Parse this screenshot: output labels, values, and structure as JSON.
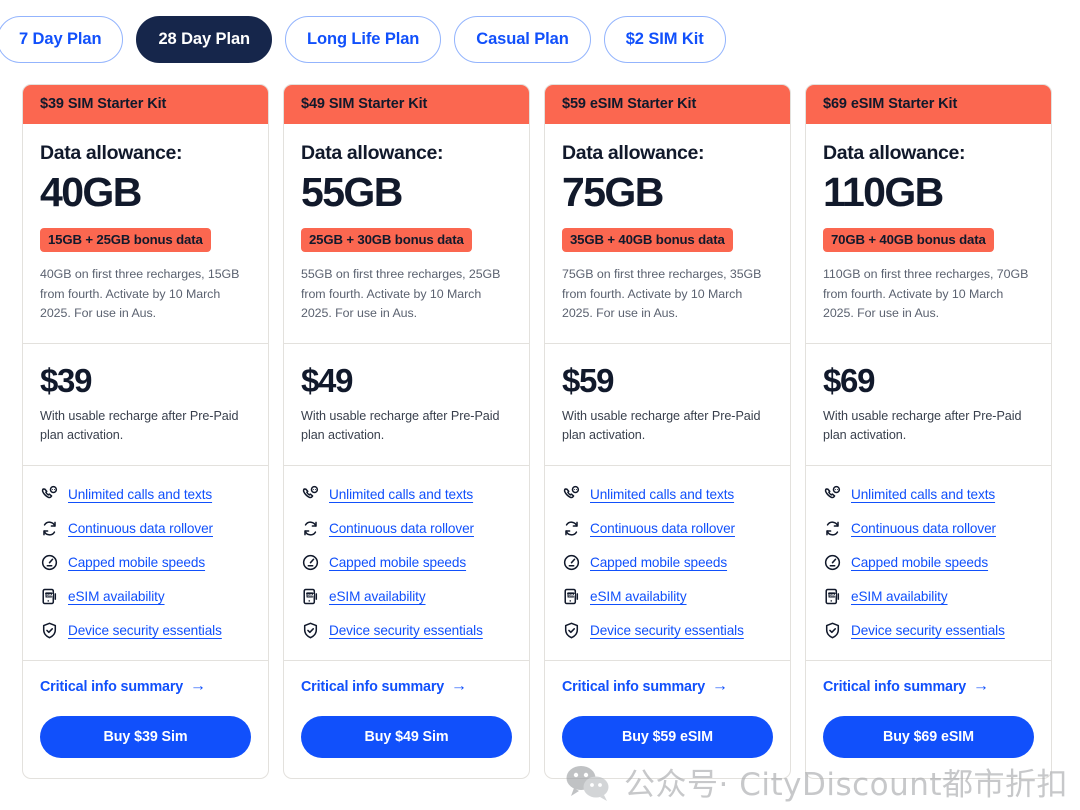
{
  "tabs": [
    {
      "label": "7 Day Plan",
      "active": false
    },
    {
      "label": "28 Day Plan",
      "active": true
    },
    {
      "label": "Long Life Plan",
      "active": false
    },
    {
      "label": "Casual Plan",
      "active": false
    },
    {
      "label": "$2 SIM Kit",
      "active": false
    }
  ],
  "labels": {
    "data_allowance": "Data allowance:",
    "critical_info": "Critical info summary",
    "arrow": "→"
  },
  "features": [
    {
      "icon": "phone-chat-icon",
      "label": "Unlimited calls and texts"
    },
    {
      "icon": "rollover-refresh-icon",
      "label": "Continuous data rollover"
    },
    {
      "icon": "speedometer-icon",
      "label": "Capped mobile speeds"
    },
    {
      "icon": "esim-phone-icon",
      "label": "eSIM availability"
    },
    {
      "icon": "shield-check-icon",
      "label": "Device security essentials"
    }
  ],
  "cards": [
    {
      "header": "$39 SIM Starter Kit",
      "allowance_label": "Data allowance:",
      "allowance": "40GB",
      "bonus": "15GB + 25GB bonus data",
      "fine_print": "40GB on first three recharges, 15GB from fourth. Activate by 10 March 2025. For use in Aus.",
      "price": "$39",
      "price_note": "With usable recharge after Pre-Paid plan activation.",
      "critical_info": "Critical info summary",
      "buy_label": "Buy $39 Sim"
    },
    {
      "header": "$49 SIM Starter Kit",
      "allowance_label": "Data allowance:",
      "allowance": "55GB",
      "bonus": "25GB + 30GB bonus data",
      "fine_print": "55GB on first three recharges, 25GB from fourth. Activate by 10 March 2025. For use in Aus.",
      "price": "$49",
      "price_note": "With usable recharge after Pre-Paid plan activation.",
      "critical_info": "Critical info summary",
      "buy_label": "Buy $49 Sim"
    },
    {
      "header": "$59 eSIM Starter Kit",
      "allowance_label": "Data allowance:",
      "allowance": "75GB",
      "bonus": "35GB + 40GB bonus data",
      "fine_print": "75GB on first three recharges, 35GB from fourth. Activate by 10 March 2025. For use in Aus.",
      "price": "$59",
      "price_note": "With usable recharge after Pre-Paid plan activation.",
      "critical_info": "Critical info summary",
      "buy_label": "Buy $59 eSIM"
    },
    {
      "header": "$69 eSIM Starter Kit",
      "allowance_label": "Data allowance:",
      "allowance": "110GB",
      "bonus": "70GB + 40GB bonus data",
      "fine_print": "110GB on first three recharges, 70GB from fourth. Activate by 10 March 2025. For use in Aus.",
      "price": "$69",
      "price_note": "With usable recharge after Pre-Paid plan activation.",
      "critical_info": "Critical info summary",
      "buy_label": "Buy $69 eSIM"
    }
  ],
  "watermark": {
    "logo": "wechat-icon",
    "text": "公众号· CityDiscount都市折扣"
  },
  "colors": {
    "header_coral": "#fb6750",
    "brand_blue": "#1150fb",
    "navy": "#16264b",
    "text_dark": "#11192b",
    "muted": "#5b6270",
    "border": "#e3e1dd"
  }
}
